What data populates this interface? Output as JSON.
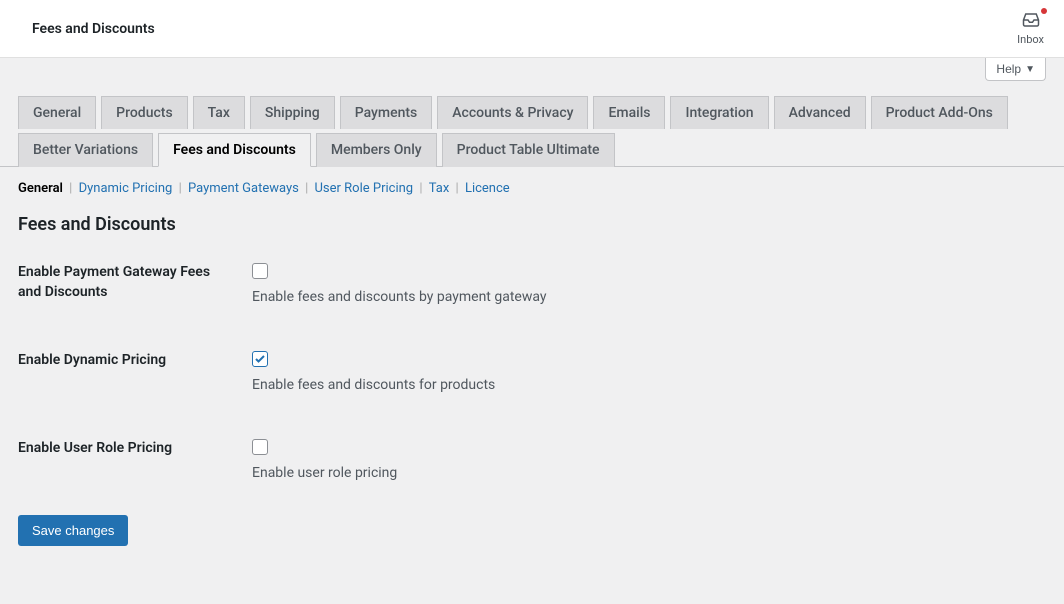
{
  "header": {
    "title": "Fees and Discounts",
    "inbox_label": "Inbox"
  },
  "help_button": "Help",
  "tabs_row1": [
    {
      "label": "General"
    },
    {
      "label": "Products"
    },
    {
      "label": "Tax"
    },
    {
      "label": "Shipping"
    },
    {
      "label": "Payments"
    },
    {
      "label": "Accounts & Privacy"
    },
    {
      "label": "Emails"
    },
    {
      "label": "Integration"
    },
    {
      "label": "Advanced"
    },
    {
      "label": "Product Add-Ons"
    }
  ],
  "tabs_row2": [
    {
      "label": "Better Variations"
    },
    {
      "label": "Fees and Discounts",
      "active": true
    },
    {
      "label": "Members Only"
    },
    {
      "label": "Product Table Ultimate"
    }
  ],
  "sublinks": [
    {
      "label": "General",
      "current": true
    },
    {
      "label": "Dynamic Pricing"
    },
    {
      "label": "Payment Gateways"
    },
    {
      "label": "User Role Pricing"
    },
    {
      "label": "Tax"
    },
    {
      "label": "Licence"
    }
  ],
  "section_title": "Fees and Discounts",
  "settings": [
    {
      "label": "Enable Payment Gateway Fees and Discounts",
      "checked": false,
      "desc": "Enable fees and discounts by payment gateway"
    },
    {
      "label": "Enable Dynamic Pricing",
      "checked": true,
      "desc": "Enable fees and discounts for products"
    },
    {
      "label": "Enable User Role Pricing",
      "checked": false,
      "desc": "Enable user role pricing"
    }
  ],
  "save_button": "Save changes"
}
